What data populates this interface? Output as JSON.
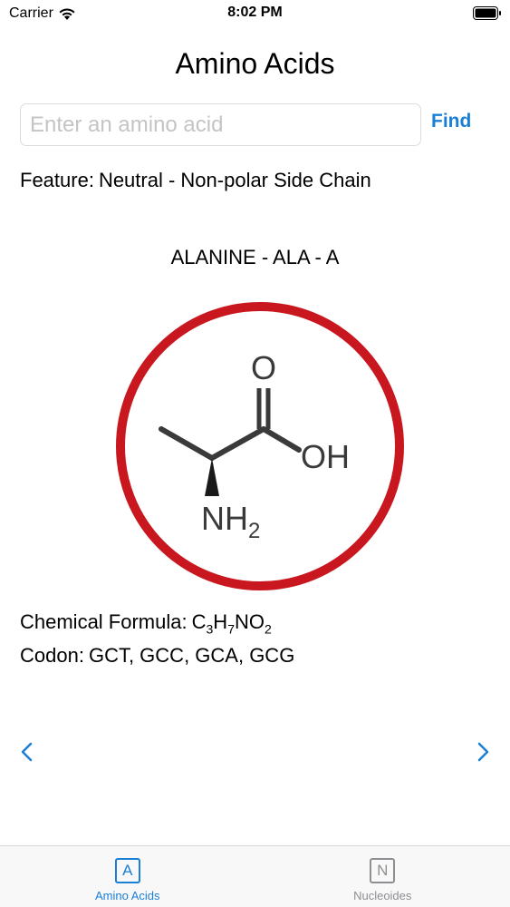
{
  "status_bar": {
    "carrier": "Carrier",
    "time": "8:02 PM",
    "wifi_icon": "wifi-icon",
    "battery_icon": "battery-icon"
  },
  "nav": {
    "title": "Amino Acids"
  },
  "search": {
    "value": "",
    "placeholder": "Enter an amino acid",
    "button_label": "Find"
  },
  "feature": {
    "label": "Feature:",
    "value": "Neutral - Non-polar Side Chain"
  },
  "acid": {
    "name": "ALANINE - ALA - A",
    "structure_labels": {
      "oxygen": "O",
      "hydroxyl": "OH",
      "amine": "NH",
      "amine_subscript": "2"
    },
    "ring_color": "#c8171e"
  },
  "formula": {
    "label": "Chemical Formula:",
    "parts": [
      "C",
      "3",
      "H",
      "7",
      "NO",
      "2"
    ]
  },
  "codon": {
    "label": "Codon:",
    "value": "GCT, GCC, GCA, GCG"
  },
  "navigation": {
    "prev_icon": "chevron-left-icon",
    "next_icon": "chevron-right-icon"
  },
  "tabs": [
    {
      "icon_letter": "A",
      "label": "Amino Acids",
      "active": true
    },
    {
      "icon_letter": "N",
      "label": "Nucleoides",
      "active": false
    }
  ],
  "colors": {
    "accent": "#1a7fd6",
    "inactive": "#8e8e93"
  }
}
